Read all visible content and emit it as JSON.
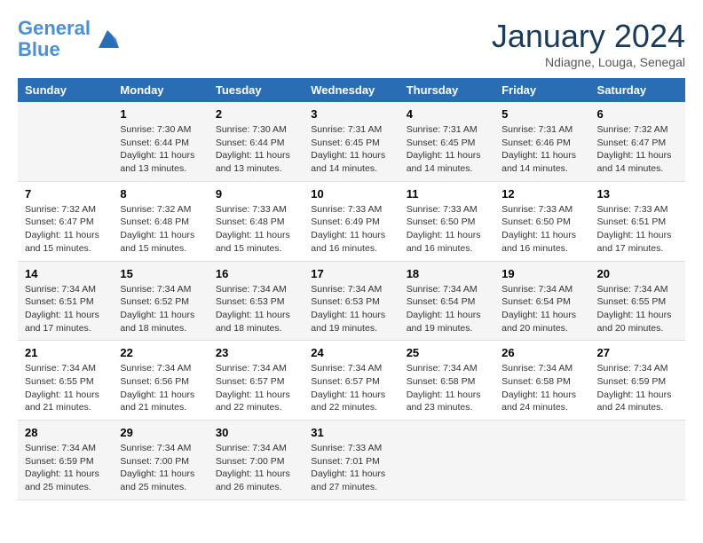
{
  "header": {
    "logo_line1": "General",
    "logo_line2": "Blue",
    "month_title": "January 2024",
    "subtitle": "Ndiagne, Louga, Senegal"
  },
  "days_of_week": [
    "Sunday",
    "Monday",
    "Tuesday",
    "Wednesday",
    "Thursday",
    "Friday",
    "Saturday"
  ],
  "weeks": [
    [
      {
        "day": "",
        "info": ""
      },
      {
        "day": "1",
        "info": "Sunrise: 7:30 AM\nSunset: 6:44 PM\nDaylight: 11 hours\nand 13 minutes."
      },
      {
        "day": "2",
        "info": "Sunrise: 7:30 AM\nSunset: 6:44 PM\nDaylight: 11 hours\nand 13 minutes."
      },
      {
        "day": "3",
        "info": "Sunrise: 7:31 AM\nSunset: 6:45 PM\nDaylight: 11 hours\nand 14 minutes."
      },
      {
        "day": "4",
        "info": "Sunrise: 7:31 AM\nSunset: 6:45 PM\nDaylight: 11 hours\nand 14 minutes."
      },
      {
        "day": "5",
        "info": "Sunrise: 7:31 AM\nSunset: 6:46 PM\nDaylight: 11 hours\nand 14 minutes."
      },
      {
        "day": "6",
        "info": "Sunrise: 7:32 AM\nSunset: 6:47 PM\nDaylight: 11 hours\nand 14 minutes."
      }
    ],
    [
      {
        "day": "7",
        "info": "Sunrise: 7:32 AM\nSunset: 6:47 PM\nDaylight: 11 hours\nand 15 minutes."
      },
      {
        "day": "8",
        "info": "Sunrise: 7:32 AM\nSunset: 6:48 PM\nDaylight: 11 hours\nand 15 minutes."
      },
      {
        "day": "9",
        "info": "Sunrise: 7:33 AM\nSunset: 6:48 PM\nDaylight: 11 hours\nand 15 minutes."
      },
      {
        "day": "10",
        "info": "Sunrise: 7:33 AM\nSunset: 6:49 PM\nDaylight: 11 hours\nand 16 minutes."
      },
      {
        "day": "11",
        "info": "Sunrise: 7:33 AM\nSunset: 6:50 PM\nDaylight: 11 hours\nand 16 minutes."
      },
      {
        "day": "12",
        "info": "Sunrise: 7:33 AM\nSunset: 6:50 PM\nDaylight: 11 hours\nand 16 minutes."
      },
      {
        "day": "13",
        "info": "Sunrise: 7:33 AM\nSunset: 6:51 PM\nDaylight: 11 hours\nand 17 minutes."
      }
    ],
    [
      {
        "day": "14",
        "info": "Sunrise: 7:34 AM\nSunset: 6:51 PM\nDaylight: 11 hours\nand 17 minutes."
      },
      {
        "day": "15",
        "info": "Sunrise: 7:34 AM\nSunset: 6:52 PM\nDaylight: 11 hours\nand 18 minutes."
      },
      {
        "day": "16",
        "info": "Sunrise: 7:34 AM\nSunset: 6:53 PM\nDaylight: 11 hours\nand 18 minutes."
      },
      {
        "day": "17",
        "info": "Sunrise: 7:34 AM\nSunset: 6:53 PM\nDaylight: 11 hours\nand 19 minutes."
      },
      {
        "day": "18",
        "info": "Sunrise: 7:34 AM\nSunset: 6:54 PM\nDaylight: 11 hours\nand 19 minutes."
      },
      {
        "day": "19",
        "info": "Sunrise: 7:34 AM\nSunset: 6:54 PM\nDaylight: 11 hours\nand 20 minutes."
      },
      {
        "day": "20",
        "info": "Sunrise: 7:34 AM\nSunset: 6:55 PM\nDaylight: 11 hours\nand 20 minutes."
      }
    ],
    [
      {
        "day": "21",
        "info": "Sunrise: 7:34 AM\nSunset: 6:55 PM\nDaylight: 11 hours\nand 21 minutes."
      },
      {
        "day": "22",
        "info": "Sunrise: 7:34 AM\nSunset: 6:56 PM\nDaylight: 11 hours\nand 21 minutes."
      },
      {
        "day": "23",
        "info": "Sunrise: 7:34 AM\nSunset: 6:57 PM\nDaylight: 11 hours\nand 22 minutes."
      },
      {
        "day": "24",
        "info": "Sunrise: 7:34 AM\nSunset: 6:57 PM\nDaylight: 11 hours\nand 22 minutes."
      },
      {
        "day": "25",
        "info": "Sunrise: 7:34 AM\nSunset: 6:58 PM\nDaylight: 11 hours\nand 23 minutes."
      },
      {
        "day": "26",
        "info": "Sunrise: 7:34 AM\nSunset: 6:58 PM\nDaylight: 11 hours\nand 24 minutes."
      },
      {
        "day": "27",
        "info": "Sunrise: 7:34 AM\nSunset: 6:59 PM\nDaylight: 11 hours\nand 24 minutes."
      }
    ],
    [
      {
        "day": "28",
        "info": "Sunrise: 7:34 AM\nSunset: 6:59 PM\nDaylight: 11 hours\nand 25 minutes."
      },
      {
        "day": "29",
        "info": "Sunrise: 7:34 AM\nSunset: 7:00 PM\nDaylight: 11 hours\nand 25 minutes."
      },
      {
        "day": "30",
        "info": "Sunrise: 7:34 AM\nSunset: 7:00 PM\nDaylight: 11 hours\nand 26 minutes."
      },
      {
        "day": "31",
        "info": "Sunrise: 7:33 AM\nSunset: 7:01 PM\nDaylight: 11 hours\nand 27 minutes."
      },
      {
        "day": "",
        "info": ""
      },
      {
        "day": "",
        "info": ""
      },
      {
        "day": "",
        "info": ""
      }
    ]
  ]
}
